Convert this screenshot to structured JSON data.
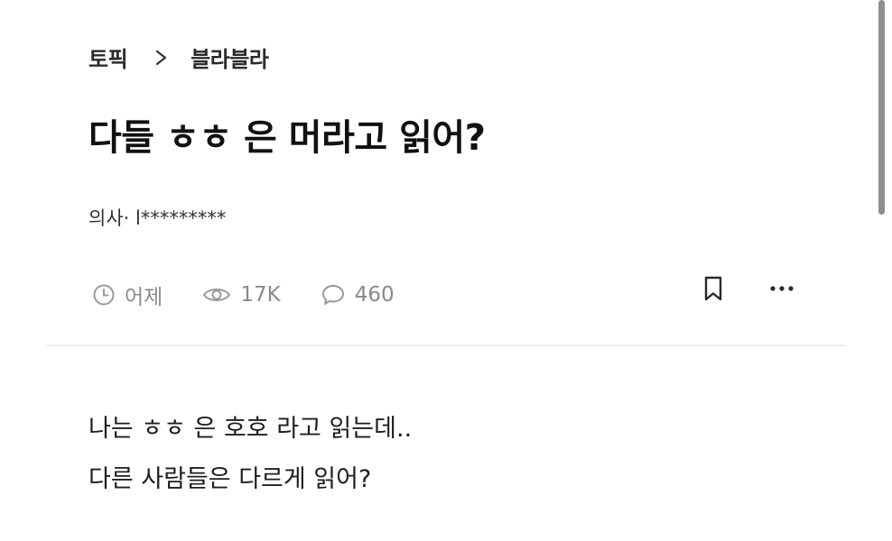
{
  "breadcrumb": {
    "category": "토픽",
    "topic": "블라블라"
  },
  "post": {
    "title": "다들 ㅎㅎ 은 머라고 읽어?",
    "author": "의사· l*********",
    "stats": {
      "time": "어제",
      "views": "17K",
      "comments": "460"
    },
    "body": [
      "나는 ㅎㅎ 은 호호 라고 읽는데..",
      "다른 사람들은 다르게 읽어?"
    ]
  },
  "icons": {
    "separator": "chevron-right-icon",
    "time": "clock-icon",
    "views": "eye-icon",
    "comments": "comment-icon",
    "bookmark": "bookmark-icon",
    "more": "more-icon"
  }
}
